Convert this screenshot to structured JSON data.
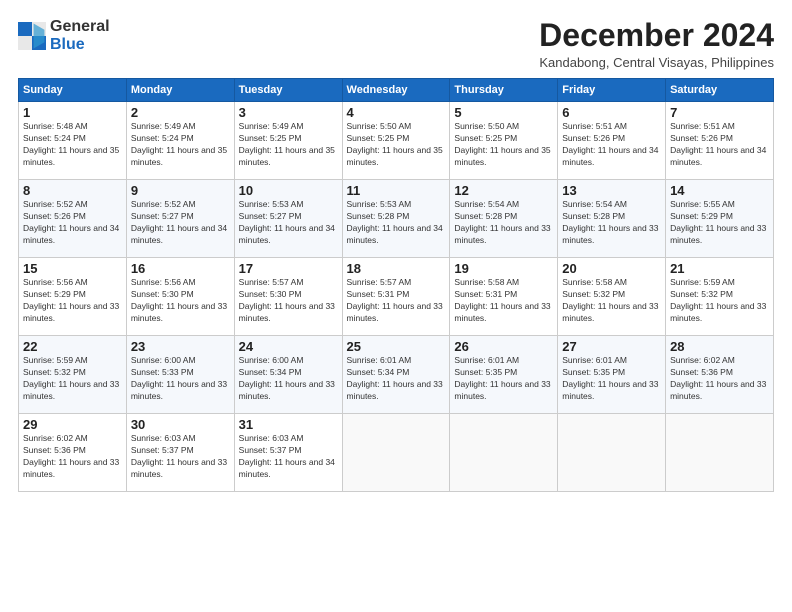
{
  "header": {
    "logo_general": "General",
    "logo_blue": "Blue",
    "month_title": "December 2024",
    "location": "Kandabong, Central Visayas, Philippines"
  },
  "days_of_week": [
    "Sunday",
    "Monday",
    "Tuesday",
    "Wednesday",
    "Thursday",
    "Friday",
    "Saturday"
  ],
  "weeks": [
    [
      {
        "day": "1",
        "sunrise": "5:48 AM",
        "sunset": "5:24 PM",
        "daylight": "11 hours and 35 minutes."
      },
      {
        "day": "2",
        "sunrise": "5:49 AM",
        "sunset": "5:24 PM",
        "daylight": "11 hours and 35 minutes."
      },
      {
        "day": "3",
        "sunrise": "5:49 AM",
        "sunset": "5:25 PM",
        "daylight": "11 hours and 35 minutes."
      },
      {
        "day": "4",
        "sunrise": "5:50 AM",
        "sunset": "5:25 PM",
        "daylight": "11 hours and 35 minutes."
      },
      {
        "day": "5",
        "sunrise": "5:50 AM",
        "sunset": "5:25 PM",
        "daylight": "11 hours and 35 minutes."
      },
      {
        "day": "6",
        "sunrise": "5:51 AM",
        "sunset": "5:26 PM",
        "daylight": "11 hours and 34 minutes."
      },
      {
        "day": "7",
        "sunrise": "5:51 AM",
        "sunset": "5:26 PM",
        "daylight": "11 hours and 34 minutes."
      }
    ],
    [
      {
        "day": "8",
        "sunrise": "5:52 AM",
        "sunset": "5:26 PM",
        "daylight": "11 hours and 34 minutes."
      },
      {
        "day": "9",
        "sunrise": "5:52 AM",
        "sunset": "5:27 PM",
        "daylight": "11 hours and 34 minutes."
      },
      {
        "day": "10",
        "sunrise": "5:53 AM",
        "sunset": "5:27 PM",
        "daylight": "11 hours and 34 minutes."
      },
      {
        "day": "11",
        "sunrise": "5:53 AM",
        "sunset": "5:28 PM",
        "daylight": "11 hours and 34 minutes."
      },
      {
        "day": "12",
        "sunrise": "5:54 AM",
        "sunset": "5:28 PM",
        "daylight": "11 hours and 33 minutes."
      },
      {
        "day": "13",
        "sunrise": "5:54 AM",
        "sunset": "5:28 PM",
        "daylight": "11 hours and 33 minutes."
      },
      {
        "day": "14",
        "sunrise": "5:55 AM",
        "sunset": "5:29 PM",
        "daylight": "11 hours and 33 minutes."
      }
    ],
    [
      {
        "day": "15",
        "sunrise": "5:56 AM",
        "sunset": "5:29 PM",
        "daylight": "11 hours and 33 minutes."
      },
      {
        "day": "16",
        "sunrise": "5:56 AM",
        "sunset": "5:30 PM",
        "daylight": "11 hours and 33 minutes."
      },
      {
        "day": "17",
        "sunrise": "5:57 AM",
        "sunset": "5:30 PM",
        "daylight": "11 hours and 33 minutes."
      },
      {
        "day": "18",
        "sunrise": "5:57 AM",
        "sunset": "5:31 PM",
        "daylight": "11 hours and 33 minutes."
      },
      {
        "day": "19",
        "sunrise": "5:58 AM",
        "sunset": "5:31 PM",
        "daylight": "11 hours and 33 minutes."
      },
      {
        "day": "20",
        "sunrise": "5:58 AM",
        "sunset": "5:32 PM",
        "daylight": "11 hours and 33 minutes."
      },
      {
        "day": "21",
        "sunrise": "5:59 AM",
        "sunset": "5:32 PM",
        "daylight": "11 hours and 33 minutes."
      }
    ],
    [
      {
        "day": "22",
        "sunrise": "5:59 AM",
        "sunset": "5:32 PM",
        "daylight": "11 hours and 33 minutes."
      },
      {
        "day": "23",
        "sunrise": "6:00 AM",
        "sunset": "5:33 PM",
        "daylight": "11 hours and 33 minutes."
      },
      {
        "day": "24",
        "sunrise": "6:00 AM",
        "sunset": "5:34 PM",
        "daylight": "11 hours and 33 minutes."
      },
      {
        "day": "25",
        "sunrise": "6:01 AM",
        "sunset": "5:34 PM",
        "daylight": "11 hours and 33 minutes."
      },
      {
        "day": "26",
        "sunrise": "6:01 AM",
        "sunset": "5:35 PM",
        "daylight": "11 hours and 33 minutes."
      },
      {
        "day": "27",
        "sunrise": "6:01 AM",
        "sunset": "5:35 PM",
        "daylight": "11 hours and 33 minutes."
      },
      {
        "day": "28",
        "sunrise": "6:02 AM",
        "sunset": "5:36 PM",
        "daylight": "11 hours and 33 minutes."
      }
    ],
    [
      {
        "day": "29",
        "sunrise": "6:02 AM",
        "sunset": "5:36 PM",
        "daylight": "11 hours and 33 minutes."
      },
      {
        "day": "30",
        "sunrise": "6:03 AM",
        "sunset": "5:37 PM",
        "daylight": "11 hours and 33 minutes."
      },
      {
        "day": "31",
        "sunrise": "6:03 AM",
        "sunset": "5:37 PM",
        "daylight": "11 hours and 34 minutes."
      },
      null,
      null,
      null,
      null
    ]
  ]
}
